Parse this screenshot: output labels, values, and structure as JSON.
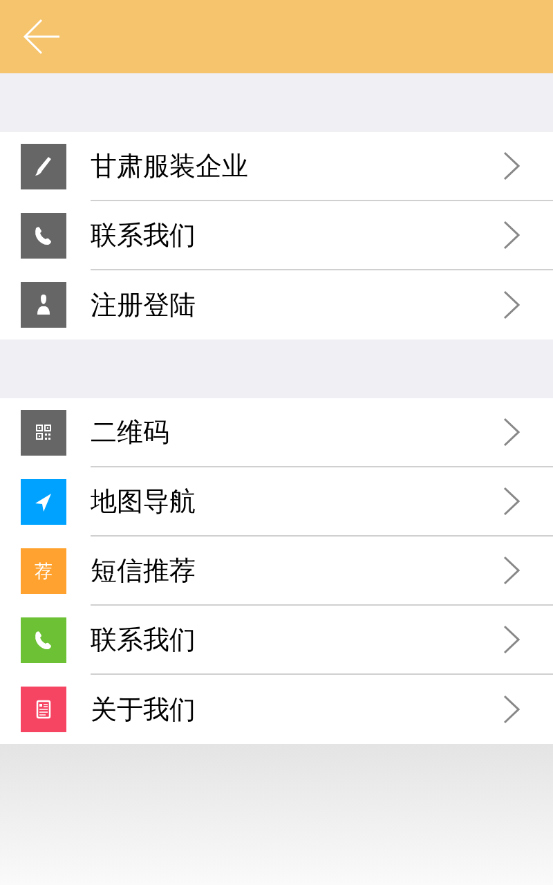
{
  "groups": [
    {
      "items": [
        {
          "label": "甘肃服装企业",
          "kind": "brush",
          "color": "#666666"
        },
        {
          "label": "联系我们",
          "kind": "phone",
          "color": "#666666"
        },
        {
          "label": "注册登陆",
          "kind": "person",
          "color": "#666666"
        }
      ]
    },
    {
      "items": [
        {
          "label": "二维码",
          "kind": "qr",
          "color": "#666666"
        },
        {
          "label": "地图导航",
          "kind": "navigate",
          "color": "#00a2ff"
        },
        {
          "label": "短信推荐",
          "kind": "text",
          "icon_text": "荐",
          "color": "#ffa22f"
        },
        {
          "label": "联系我们",
          "kind": "phone",
          "color": "#6cc135"
        },
        {
          "label": "关于我们",
          "kind": "doc",
          "color": "#f64463"
        }
      ]
    }
  ]
}
